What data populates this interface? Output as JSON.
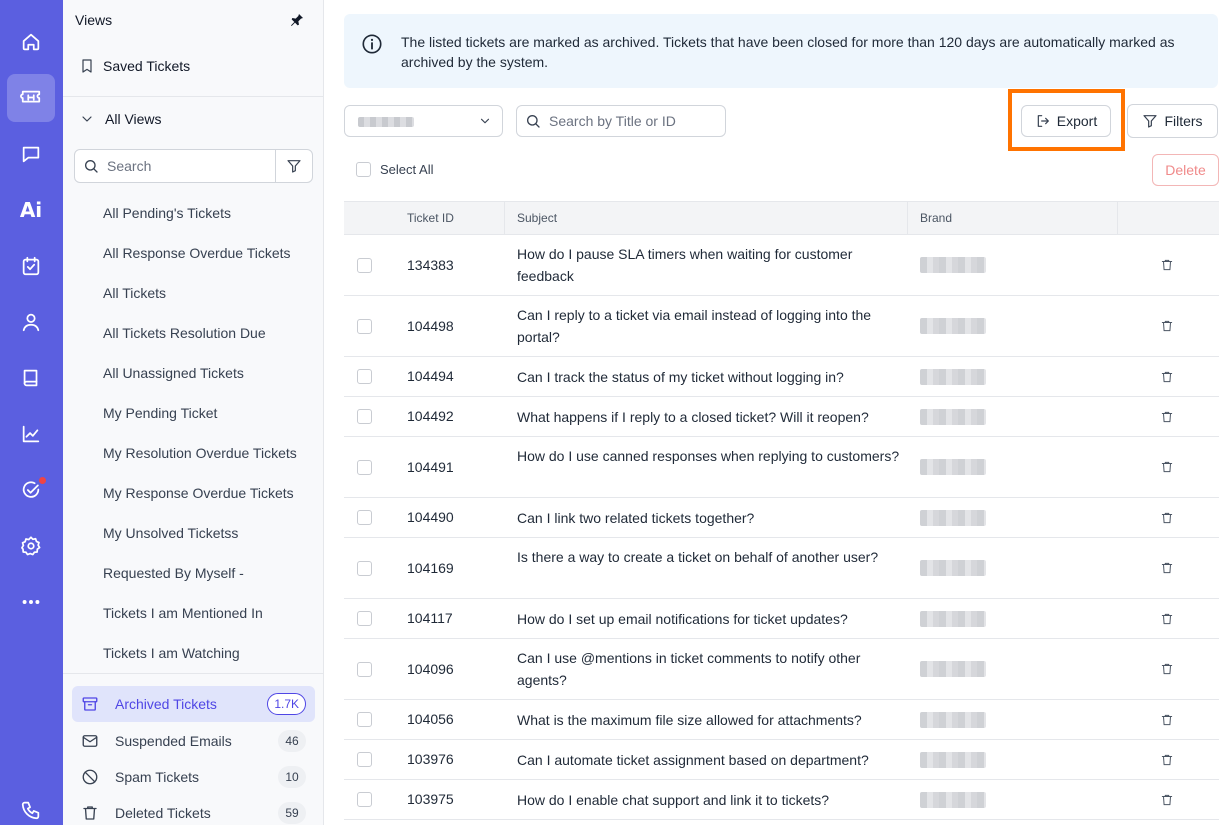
{
  "rail": {
    "items": [
      {
        "name": "home-icon"
      },
      {
        "name": "tickets-icon",
        "active": true
      },
      {
        "name": "chat-icon"
      },
      {
        "name": "ai-icon",
        "label": "Ai"
      },
      {
        "name": "tasks-icon"
      },
      {
        "name": "contacts-icon"
      },
      {
        "name": "knowledge-base-icon"
      },
      {
        "name": "reports-icon"
      },
      {
        "name": "approvals-icon",
        "notification": true
      },
      {
        "name": "settings-icon"
      },
      {
        "name": "more-icon"
      },
      {
        "name": "phone-icon"
      }
    ]
  },
  "views": {
    "title": "Views",
    "saved_label": "Saved Tickets",
    "all_views_label": "All Views",
    "search_placeholder": "Search",
    "items": [
      "All Pending's Tickets",
      "All Response Overdue Tickets",
      "All Tickets",
      "All Tickets Resolution Due",
      "All Unassigned Tickets",
      "My Pending Ticket",
      "My Resolution Overdue Tickets",
      "My Response Overdue Tickets",
      "My Unsolved Ticketss",
      "Requested By Myself -",
      "Tickets I am Mentioned In",
      "Tickets I am Watching"
    ],
    "special": [
      {
        "label": "Archived Tickets",
        "count": "1.7K",
        "active": true,
        "icon": "archive-icon"
      },
      {
        "label": "Suspended Emails",
        "count": "46",
        "icon": "mail-icon"
      },
      {
        "label": "Spam Tickets",
        "count": "10",
        "icon": "block-icon"
      },
      {
        "label": "Deleted Tickets",
        "count": "59",
        "icon": "trash-icon"
      }
    ]
  },
  "main": {
    "banner_text": "The listed tickets are marked as archived. Tickets that have been closed for more than 120 days are automatically marked as archived by the system.",
    "search_placeholder": "Search by Title or ID",
    "export_label": "Export",
    "filters_label": "Filters",
    "select_all_label": "Select All",
    "delete_label": "Delete",
    "columns": [
      "Ticket ID",
      "Subject",
      "Brand"
    ],
    "rows": [
      {
        "id": "134383",
        "subject": "How do I pause SLA timers when waiting for customer feedback"
      },
      {
        "id": "104498",
        "subject": "Can I reply to a ticket via email instead of logging into the portal?"
      },
      {
        "id": "104494",
        "subject": "Can I track the status of my ticket without logging in?"
      },
      {
        "id": "104492",
        "subject": "What happens if I reply to a closed ticket? Will it reopen?"
      },
      {
        "id": "104491",
        "subject": "How do I use canned responses when replying to customers?"
      },
      {
        "id": "104490",
        "subject": "Can I link two related tickets together?"
      },
      {
        "id": "104169",
        "subject": "Is there a way to create a ticket on behalf of another user?"
      },
      {
        "id": "104117",
        "subject": "How do I set up email notifications for ticket updates?"
      },
      {
        "id": "104096",
        "subject": "Can I use @mentions in ticket comments to notify other agents?"
      },
      {
        "id": "104056",
        "subject": "What is the maximum file size allowed for attachments?"
      },
      {
        "id": "103976",
        "subject": "Can I automate ticket assignment based on department?"
      },
      {
        "id": "103975",
        "subject": "How do I enable chat support and link it to tickets?"
      }
    ]
  },
  "colors": {
    "rail": "#5b5fe0",
    "accent": "#4f46e5",
    "highlight": "#ff7300",
    "banner": "#eef6fd"
  }
}
